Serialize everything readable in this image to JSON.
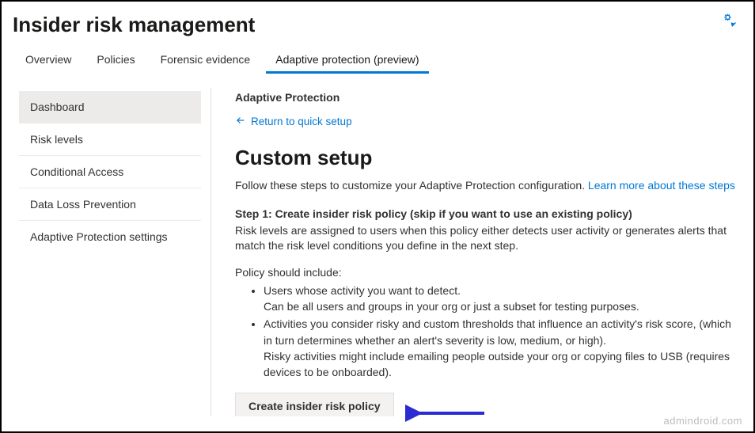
{
  "header": {
    "title": "Insider risk management"
  },
  "tabs": [
    {
      "label": "Overview"
    },
    {
      "label": "Policies"
    },
    {
      "label": "Forensic evidence"
    },
    {
      "label": "Adaptive protection (preview)"
    }
  ],
  "sidebar": {
    "items": [
      {
        "label": "Dashboard"
      },
      {
        "label": "Risk levels"
      },
      {
        "label": "Conditional Access"
      },
      {
        "label": "Data Loss Prevention"
      },
      {
        "label": "Adaptive Protection settings"
      }
    ]
  },
  "main": {
    "section_title": "Adaptive Protection",
    "return_label": "Return to quick setup",
    "heading": "Custom setup",
    "description_prefix": "Follow these steps to customize your Adaptive Protection configuration. ",
    "learn_more": "Learn more about these steps",
    "step1_title": "Step 1: Create insider risk policy (skip if you want to use an existing policy)",
    "step1_desc": "Risk levels are assigned to users when this policy either detects user activity or generates alerts that match the risk level conditions you define in the next step.",
    "policy_include_label": "Policy should include:",
    "bullets": {
      "b1_line1": "Users whose activity you want to detect.",
      "b1_line2": "Can be all users and groups in your org or just a subset for testing purposes.",
      "b2_line1": "Activities you consider risky and custom thresholds that influence an activity's risk score, (which in turn determines whether an alert's severity is low, medium, or high).",
      "b2_line2": "Risky activities might include emailing people outside your org or copying files to USB (requires devices to be onboarded)."
    },
    "create_button": "Create insider risk policy"
  },
  "watermark": "admindroid.com"
}
